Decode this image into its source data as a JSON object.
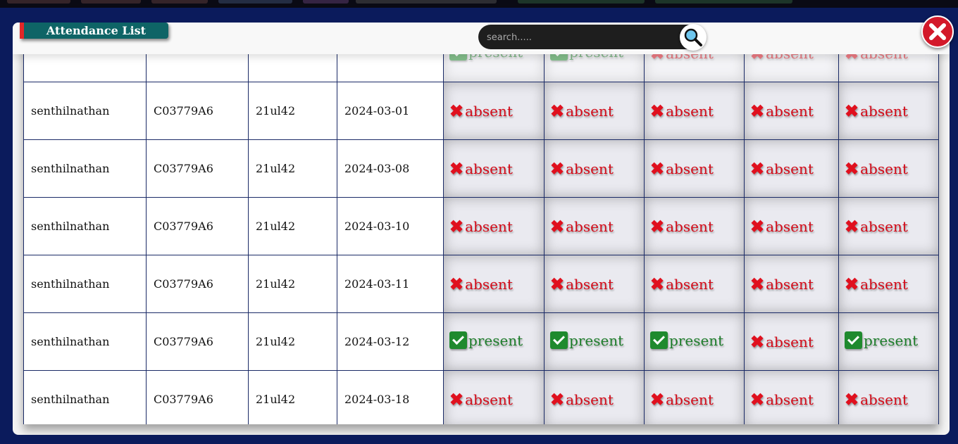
{
  "modal": {
    "title": "Attendance List",
    "search": {
      "placeholder": "search....."
    }
  },
  "status_labels": {
    "absent": "absent",
    "present": "present"
  },
  "table": {
    "rows": [
      {
        "name": "",
        "code": "",
        "id": "",
        "date": "",
        "statuses": [
          "present",
          "present",
          "absent",
          "absent",
          "absent"
        ],
        "clipped": true
      },
      {
        "name": "senthilnathan",
        "code": "C03779A6",
        "id": "21ul42",
        "date": "2024-03-01",
        "statuses": [
          "absent",
          "absent",
          "absent",
          "absent",
          "absent"
        ]
      },
      {
        "name": "senthilnathan",
        "code": "C03779A6",
        "id": "21ul42",
        "date": "2024-03-08",
        "statuses": [
          "absent",
          "absent",
          "absent",
          "absent",
          "absent"
        ]
      },
      {
        "name": "senthilnathan",
        "code": "C03779A6",
        "id": "21ul42",
        "date": "2024-03-10",
        "statuses": [
          "absent",
          "absent",
          "absent",
          "absent",
          "absent"
        ]
      },
      {
        "name": "senthilnathan",
        "code": "C03779A6",
        "id": "21ul42",
        "date": "2024-03-11",
        "statuses": [
          "absent",
          "absent",
          "absent",
          "absent",
          "absent"
        ]
      },
      {
        "name": "senthilnathan",
        "code": "C03779A6",
        "id": "21ul42",
        "date": "2024-03-12",
        "statuses": [
          "present",
          "present",
          "present",
          "absent",
          "present"
        ]
      },
      {
        "name": "senthilnathan",
        "code": "C03779A6",
        "id": "21ul42",
        "date": "2024-03-18",
        "statuses": [
          "absent",
          "absent",
          "absent",
          "absent",
          "absent"
        ]
      }
    ]
  },
  "colors": {
    "background": "#0b1b5c",
    "title_tag": "#0e6466",
    "title_accent": "#e02828",
    "absent": "#d40a18",
    "present": "#1d7d2a",
    "close_button": "#d3192a"
  },
  "icons": {
    "search": "magnifier-icon",
    "close": "close-icon",
    "absent": "cross-icon",
    "present": "check-icon"
  }
}
